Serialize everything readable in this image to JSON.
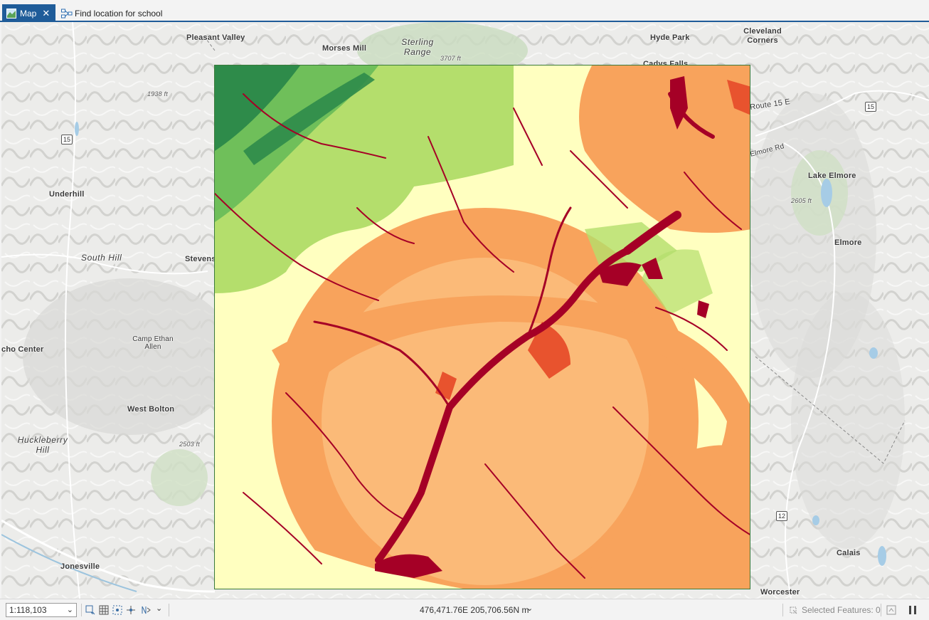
{
  "tabs": [
    {
      "label": "Map",
      "icon": "map-icon",
      "active": true
    },
    {
      "label": "Find location for school",
      "icon": "model-icon",
      "active": false
    }
  ],
  "map_labels": {
    "pleasant_valley": "Pleasant Valley",
    "morses_mill": "Morses Mill",
    "sterling_range": "Sterling Range",
    "elev_3707": "3707 ft",
    "hyde_park": "Hyde Park",
    "cleveland_corners": "Cleveland Corners",
    "cadys_falls": "Cadys Falls",
    "route_15e": "Route 15 E",
    "elmore_rd": "Elmore Rd",
    "elev_1938": "1938 ft",
    "underhill": "Underhill",
    "lake_elmore": "Lake Elmore",
    "elev_2605": "2605 ft",
    "elmore": "Elmore",
    "south_hill": "South Hill",
    "stevens": "Stevens",
    "echo_center": "cho Center",
    "camp_ethan_allen": "Camp Ethan Allen",
    "west_bolton": "West Bolton",
    "huckleberry_hill": "Huckleberry Hill",
    "elev_2503": "2503 ft",
    "jonesville": "Jonesville",
    "calais": "Calais",
    "worcester": "Worcester"
  },
  "shields": {
    "r15_left": "15",
    "r15_right": "15",
    "r12": "12"
  },
  "status": {
    "scale": "1:118,103",
    "coordinates": "476,471.76E 205,706.56N m",
    "selected_features": "Selected Features: 0"
  },
  "colors": {
    "dark_green": "#2e8b4a",
    "mid_green": "#6fbf5a",
    "light_green": "#b4de6c",
    "pale_yellow": "#ffffc0",
    "light_orange": "#fdc98a",
    "orange": "#f8a35c",
    "red_orange": "#e8532e",
    "dark_red": "#a50026",
    "accent_blue": "#1f5c99"
  }
}
